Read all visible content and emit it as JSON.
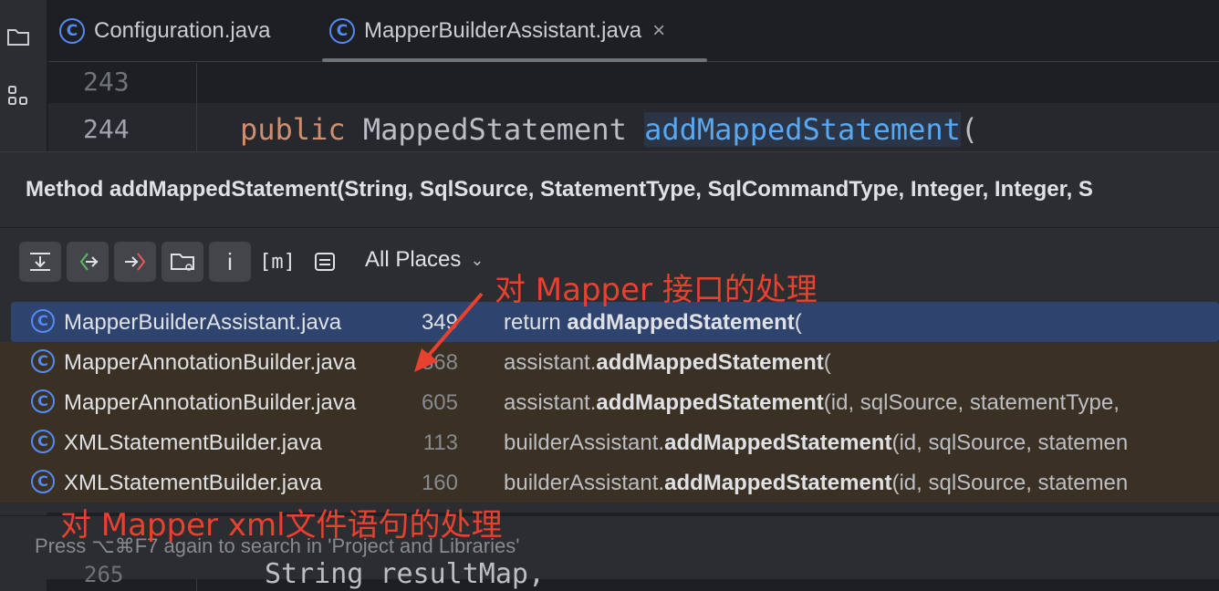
{
  "tabs": [
    {
      "label": "Configuration.java",
      "icon": "class-icon",
      "active": false
    },
    {
      "label": "MapperBuilderAssistant.java",
      "icon": "class-icon",
      "active": true,
      "close": "×"
    }
  ],
  "sidebar": {
    "icons": [
      "folder-icon",
      "structure-icon"
    ]
  },
  "editor": {
    "lines": [
      {
        "number": "243",
        "code": ""
      },
      {
        "number": "244",
        "keyword": "public",
        "type": "MappedStatement",
        "method": "addMappedStatement",
        "paren": "("
      }
    ],
    "below_line_number": "265",
    "below_code": "String resultMap,"
  },
  "popup": {
    "title": "Method addMappedStatement(String, SqlSource, StatementType, SqlCommandType, Integer, Integer, S",
    "toolbar_icons": [
      "expand-icon",
      "read-access-icon",
      "write-access-icon",
      "module-filter-icon",
      "info-icon",
      "merge-icon",
      "preview-icon"
    ],
    "toolbar_m_label": "[m]",
    "toolbar_i_label": "i",
    "scope": "All Places",
    "results": [
      {
        "file": "MapperBuilderAssistant.java",
        "line": "349",
        "prefix": "return ",
        "match": "addMappedStatement",
        "suffix": "(",
        "selected": true
      },
      {
        "file": "MapperAnnotationBuilder.java",
        "line": "368",
        "prefix": "assistant.",
        "match": "addMappedStatement",
        "suffix": "(",
        "selected": false
      },
      {
        "file": "MapperAnnotationBuilder.java",
        "line": "605",
        "prefix": "assistant.",
        "match": "addMappedStatement",
        "suffix": "(id, sqlSource, statementType,",
        "selected": false
      },
      {
        "file": "XMLStatementBuilder.java",
        "line": "113",
        "prefix": "builderAssistant.",
        "match": "addMappedStatement",
        "suffix": "(id, sqlSource, statemen",
        "selected": false
      },
      {
        "file": "XMLStatementBuilder.java",
        "line": "160",
        "prefix": "builderAssistant.",
        "match": "addMappedStatement",
        "suffix": "(id, sqlSource, statemen",
        "selected": false
      }
    ],
    "footer": "Press ⌥⌘F7 again to search in 'Project and Libraries'"
  },
  "annotations": {
    "mapper_interface": "对 Mapper 接口的处理",
    "mapper_xml": "对 Mapper xml文件语句的处理",
    "color": "#e8412f"
  }
}
